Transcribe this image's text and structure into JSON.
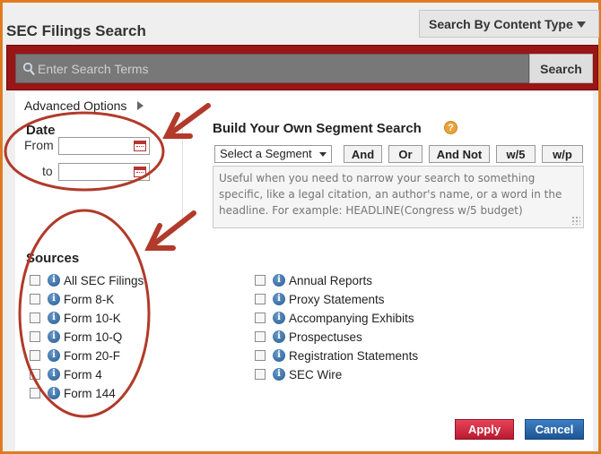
{
  "header": {
    "title": "SEC Filings Search",
    "content_type_label": "Search By Content Type"
  },
  "search": {
    "placeholder": "Enter Search Terms",
    "button_label": "Search"
  },
  "advanced": {
    "label": "Advanced Options"
  },
  "date": {
    "heading": "Date",
    "from_label": "From",
    "to_label": "to",
    "from_value": "",
    "to_value": ""
  },
  "segment": {
    "heading": "Build Your Own Segment Search",
    "help_icon": "?",
    "select_value": "Select a Segment",
    "operators": [
      "And",
      "Or",
      "And Not",
      "w/5",
      "w/p"
    ],
    "textarea_placeholder": "Useful when you need to narrow your search to something specific, like a legal citation, an author's name, or a word in the headline. For example: HEADLINE(Congress w/5 budget)"
  },
  "sources": {
    "heading": "Sources",
    "info_glyph": "i",
    "left": [
      {
        "label": "All SEC Filings",
        "checked": false
      },
      {
        "label": "Form 8-K",
        "checked": false
      },
      {
        "label": "Form 10-K",
        "checked": false
      },
      {
        "label": "Form 10-Q",
        "checked": false
      },
      {
        "label": "Form 20-F",
        "checked": false
      },
      {
        "label": "Form 4",
        "checked": false
      },
      {
        "label": "Form 144",
        "checked": false
      }
    ],
    "right": [
      {
        "label": "Annual Reports",
        "checked": false
      },
      {
        "label": "Proxy Statements",
        "checked": false
      },
      {
        "label": "Accompanying Exhibits",
        "checked": false
      },
      {
        "label": "Prospectuses",
        "checked": false
      },
      {
        "label": "Registration Statements",
        "checked": false
      },
      {
        "label": "SEC Wire",
        "checked": false
      }
    ]
  },
  "footer": {
    "apply_label": "Apply",
    "cancel_label": "Cancel"
  },
  "colors": {
    "frame_orange": "#e07a1f",
    "search_bar_red": "#9a1515",
    "annotation_red": "#b13a2a",
    "apply_red": "#c8223a",
    "cancel_blue": "#2a66a8",
    "info_blue": "#235a95"
  }
}
